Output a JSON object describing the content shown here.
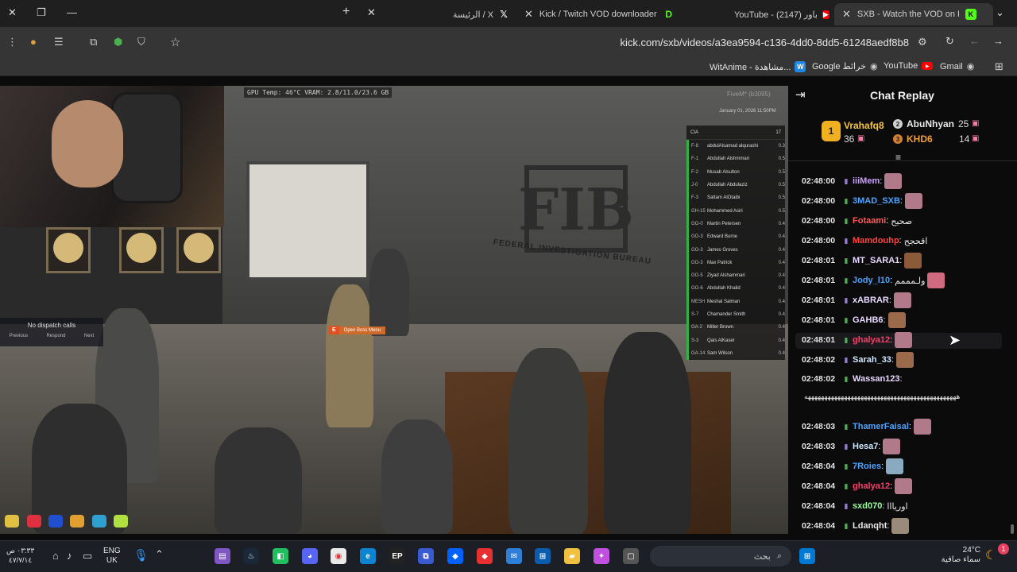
{
  "browser": {
    "tabs": [
      {
        "label": "SXB - Watch the VOD on Ki",
        "favicon": "kick-icon",
        "color": "#53fc18"
      },
      {
        "label": "YouTube - باور (2147)",
        "favicon": "youtube-icon",
        "color": "#ff0000"
      },
      {
        "label": "Kick / Twitch VOD downloader",
        "favicon": "d-icon",
        "color": "#53fc18"
      },
      {
        "label": "الرئيسة / X",
        "favicon": "x-icon",
        "color": "#ffffff"
      }
    ],
    "url": "kick.com/sxb/videos/a3ea9594-c136-4dd0-8dd5-61248aedf8b8",
    "bookmarks": [
      {
        "label": "Gmail",
        "icon": "chrome-icon"
      },
      {
        "label": "YouTube",
        "icon": "youtube-icon"
      },
      {
        "label": "Google خرائط",
        "icon": "chrome-icon"
      },
      {
        "label": "WitAnime - مشاهدة...",
        "icon": "w-icon"
      }
    ]
  },
  "video": {
    "osd": "GPU Temp: 46°C  VRAM: 2.8/11.0/23.6 GB",
    "fivem": "FiveM* (b3095)",
    "datetime": "January 01, 2026 11:50PM",
    "roster_title": "CIA",
    "roster_count": "17",
    "roster": [
      {
        "code": "F-8",
        "name": "abdulAlsamad alqurashi",
        "val": "0.3"
      },
      {
        "code": "F-1",
        "name": "Abdullah Alshmmari",
        "val": "0.5"
      },
      {
        "code": "F-2",
        "name": "Musab Alsulton",
        "val": "0.5"
      },
      {
        "code": "J-0",
        "name": "Abdullah Abdulaziz",
        "val": "0.5"
      },
      {
        "code": "F-3",
        "name": "Sattam AlOtaibi",
        "val": "0.5"
      },
      {
        "code": "GH-15",
        "name": "Mohammed Asiri",
        "val": "0.5"
      },
      {
        "code": "GO-0",
        "name": "Martin Petersen",
        "val": "0.4"
      },
      {
        "code": "GO-3",
        "name": "Edward Burne",
        "val": "0.4"
      },
      {
        "code": "GO-3",
        "name": "James Groves",
        "val": "0.4"
      },
      {
        "code": "GO-3",
        "name": "Max Patrick",
        "val": "0.4"
      },
      {
        "code": "GO-5",
        "name": "Ziyad Alshammari",
        "val": "0.4"
      },
      {
        "code": "GO-6",
        "name": "Abdullah Khalid",
        "val": "0.4"
      },
      {
        "code": "MESH",
        "name": "Meshal Salman",
        "val": "0.4"
      },
      {
        "code": "S-7",
        "name": "Chamander Smith",
        "val": "0.4"
      },
      {
        "code": "GA-2",
        "name": "Miller Brown",
        "val": "0.4"
      },
      {
        "code": "S-3",
        "name": "Qais AlKaser",
        "val": "0.4"
      },
      {
        "code": "GA-14",
        "name": "Sam Wilson",
        "val": "0.4"
      }
    ],
    "dispatch": {
      "title": "No dispatch calls",
      "prev": "Previous",
      "respond": "Respond",
      "next": "Next"
    },
    "boss_key": "E",
    "boss_label": "Open Boss Menu",
    "sign_main": "FIB",
    "sign_sub": "FEDERAL INVESTIGATION BUREAU"
  },
  "chat": {
    "title": "Chat Replay",
    "leaderboard": [
      {
        "rank": "1",
        "name": "Vrahafq8",
        "count": "36"
      },
      {
        "rank": "2",
        "name": "AbuNhyan",
        "count": "25"
      },
      {
        "rank": "3",
        "name": "KHD6",
        "count": "14"
      }
    ],
    "messages": [
      {
        "time": "02:48:00",
        "user": "iiiMem",
        "color": "#c9a0ff",
        "text": "",
        "emote": "#b07a8a"
      },
      {
        "time": "02:48:00",
        "user": "3MAD_SXB",
        "color": "#4aa3ff",
        "text": "",
        "emote": "#b07a8a"
      },
      {
        "time": "02:48:00",
        "user": "Fotaami",
        "color": "#ff5a5a",
        "text": "صحيح",
        "emote": ""
      },
      {
        "time": "02:48:00",
        "user": "Mamdouhp",
        "color": "#ff4040",
        "text": "اقحجح",
        "emote": ""
      },
      {
        "time": "02:48:01",
        "user": "MT_SARA1",
        "color": "#e8d8ff",
        "text": "",
        "emote": "#8a5a3a"
      },
      {
        "time": "02:48:01",
        "user": "Jody_l10",
        "color": "#4aa3ff",
        "text": "ولـمممم",
        "emote": "#d06a80"
      },
      {
        "time": "02:48:01",
        "user": "xABRAR",
        "color": "#e8d8ff",
        "text": "",
        "emote": "#b07a8a"
      },
      {
        "time": "02:48:01",
        "user": "GAHB6",
        "color": "#e8d8ff",
        "text": "",
        "emote": "#9a6a4a"
      },
      {
        "time": "02:48:01",
        "user": "ghalya12",
        "color": "#ff3b6b",
        "text": "",
        "emote": "#b07a8a"
      },
      {
        "time": "02:48:02",
        "user": "Sarah_33",
        "color": "#cfe6ff",
        "text": "",
        "emote": "#9a6a4a"
      },
      {
        "time": "02:48:02",
        "user": "Wassan123",
        "color": "#e8d8ff",
        "text": "ههههههههههههههههههههههههههههههههههههههههههههههه",
        "emote": ""
      },
      {
        "time": "02:48:03",
        "user": "ThamerFaisal",
        "color": "#4aa3ff",
        "text": "",
        "emote": "#b07a8a"
      },
      {
        "time": "02:48:03",
        "user": "Hesa7",
        "color": "#cfe6ff",
        "text": "",
        "emote": "#b07a8a"
      },
      {
        "time": "02:48:04",
        "user": "7Roies",
        "color": "#4aa3ff",
        "text": "",
        "emote": "#8aaac0"
      },
      {
        "time": "02:48:04",
        "user": "ghalya12",
        "color": "#ff3b6b",
        "text": "",
        "emote": "#b07a8a"
      },
      {
        "time": "02:48:04",
        "user": "sxd070",
        "color": "#9cff9c",
        "text": "اوريااا",
        "emote": ""
      },
      {
        "time": "02:48:04",
        "user": "Ldanqht",
        "color": "#e8e8e8",
        "text": "",
        "emote": "#9a8a7a"
      }
    ]
  },
  "taskbar": {
    "search": "بحث",
    "weather_temp": "24°C",
    "weather_desc": "سماء صافية",
    "lang_top": "ENG",
    "lang_bottom": "UK",
    "clock_time": "٠٣:٣٣ ص",
    "clock_date": "٤٧/٧/١٤",
    "notif_count": "1"
  }
}
